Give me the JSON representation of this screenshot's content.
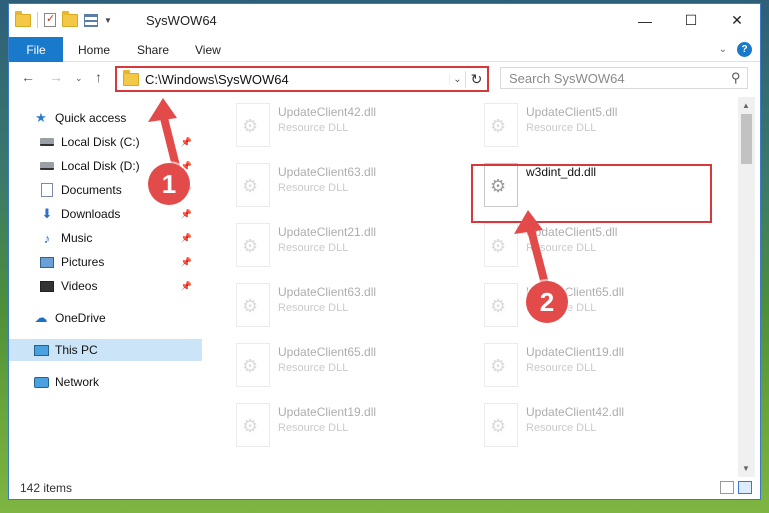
{
  "title": "SysWOW64",
  "ribbon": {
    "tabs": [
      "File",
      "Home",
      "Share",
      "View"
    ]
  },
  "address": {
    "path": "C:\\Windows\\SysWOW64",
    "search_placeholder": "Search SysWOW64"
  },
  "sidebar": {
    "items": [
      {
        "label": "Quick access",
        "icon": "star-icon"
      },
      {
        "label": "Local Disk (C:)",
        "icon": "drive-icon"
      },
      {
        "label": "Local Disk (D:)",
        "icon": "drive-icon"
      },
      {
        "label": "Documents",
        "icon": "documents-icon"
      },
      {
        "label": "Downloads",
        "icon": "downloads-icon"
      },
      {
        "label": "Music",
        "icon": "music-icon"
      },
      {
        "label": "Pictures",
        "icon": "pictures-icon"
      },
      {
        "label": "Videos",
        "icon": "videos-icon"
      },
      {
        "label": "OneDrive",
        "icon": "onedrive-icon"
      },
      {
        "label": "This PC",
        "icon": "pc-icon"
      },
      {
        "label": "Network",
        "icon": "network-icon"
      }
    ]
  },
  "files": [
    {
      "name": "UpdateClient42.dll",
      "type": "Resource DLL"
    },
    {
      "name": "UpdateClient5.dll",
      "type": "Resource DLL"
    },
    {
      "name": "UpdateClient63.dll",
      "type": "Resource DLL"
    },
    {
      "name": "w3dint_dd.dll",
      "type": ""
    },
    {
      "name": "UpdateClient21.dll",
      "type": "Resource DLL"
    },
    {
      "name": "UpdateClient5.dll",
      "type": "Resource DLL"
    },
    {
      "name": "UpdateClient63.dll",
      "type": "Resource DLL"
    },
    {
      "name": "UpdateClient65.dll",
      "type": "Resource DLL"
    },
    {
      "name": "UpdateClient65.dll",
      "type": "Resource DLL"
    },
    {
      "name": "UpdateClient19.dll",
      "type": "Resource DLL"
    },
    {
      "name": "UpdateClient19.dll",
      "type": "Resource DLL"
    },
    {
      "name": "UpdateClient42.dll",
      "type": "Resource DLL"
    }
  ],
  "status": {
    "item_count": "142 items"
  },
  "callouts": [
    "1",
    "2"
  ]
}
